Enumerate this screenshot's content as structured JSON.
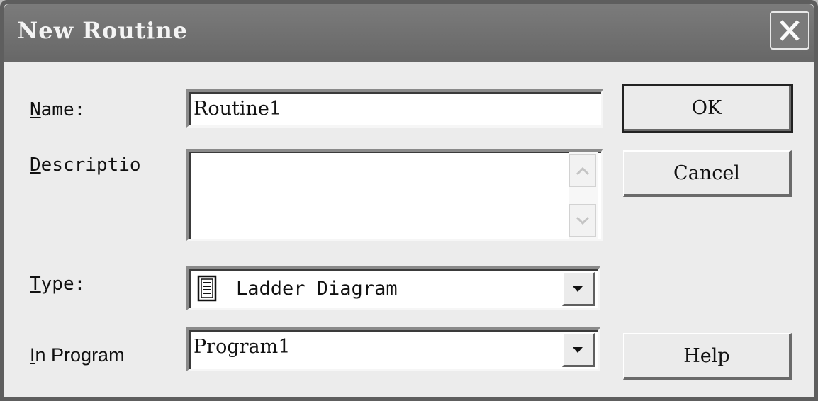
{
  "dialog": {
    "title": "New Routine"
  },
  "labels": {
    "name": "Name:",
    "description": "Descriptio",
    "type": "Type:",
    "in_program": "In Program"
  },
  "fields": {
    "name_value": "Routine1",
    "description_value": "",
    "type_value": "Ladder Diagram",
    "type_icon": "ladder-diagram-icon",
    "program_value": "Program1"
  },
  "buttons": {
    "ok": "OK",
    "cancel": "Cancel",
    "help": "Help"
  },
  "icons": {
    "close": "close-icon",
    "dropdown": "chevron-down-icon",
    "scroll_up": "scroll-up-icon",
    "scroll_down": "scroll-down-icon"
  }
}
